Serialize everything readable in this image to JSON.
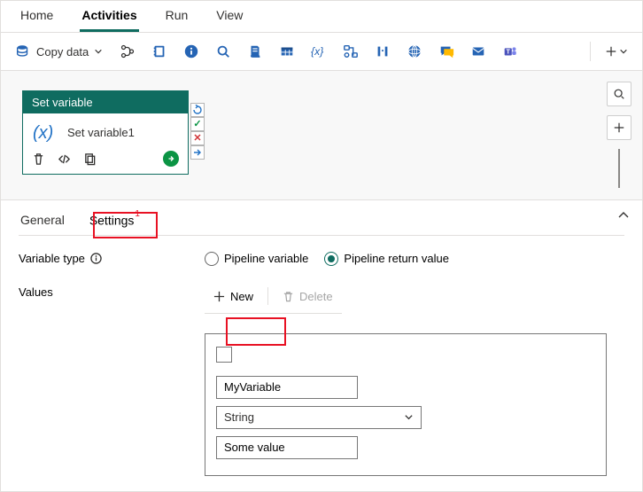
{
  "top_tabs": {
    "home": "Home",
    "activities": "Activities",
    "run": "Run",
    "view": "View"
  },
  "toolbar": {
    "copy_data": "Copy data",
    "icons": [
      "branch-icon",
      "notebook-icon",
      "info-icon",
      "search-icon",
      "script-icon",
      "table-icon",
      "variable-icon",
      "flow-icon",
      "pins-icon",
      "web-icon",
      "chat-icon",
      "mail-icon",
      "teams-icon"
    ]
  },
  "activity": {
    "type": "Set variable",
    "name": "Set variable1"
  },
  "detail_tabs": {
    "general": "General",
    "settings": "Settings",
    "settings_badge": "1"
  },
  "form": {
    "variable_type_label": "Variable type",
    "variable_type_options": {
      "pipeline_var": "Pipeline variable",
      "pipeline_return": "Pipeline return value"
    },
    "variable_type_selected": "pipeline_return",
    "values_label": "Values",
    "new_btn": "New",
    "delete_btn": "Delete",
    "entry": {
      "name": "MyVariable",
      "type": "String",
      "value": "Some value"
    }
  }
}
